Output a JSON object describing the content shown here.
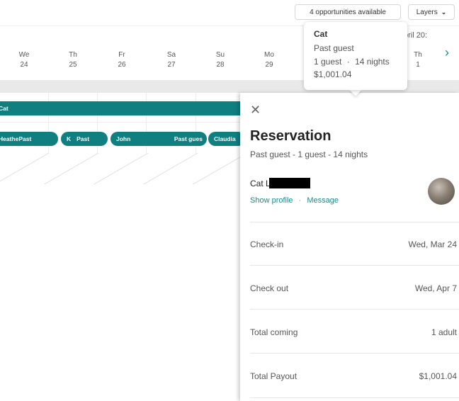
{
  "toolbar": {
    "opportunities_label": "4 opportunities available",
    "layers_label": "Layers"
  },
  "calendar": {
    "month_peek": "pril 20:",
    "days": [
      {
        "dow": "We",
        "num": "24"
      },
      {
        "dow": "Th",
        "num": "25"
      },
      {
        "dow": "Fr",
        "num": "26"
      },
      {
        "dow": "Sa",
        "num": "27"
      },
      {
        "dow": "Su",
        "num": "28"
      },
      {
        "dow": "Mo",
        "num": "29"
      },
      {
        "dow": "Th",
        "num": "1"
      }
    ],
    "bars": {
      "cat": "Cat",
      "b1": "HeathePast",
      "b2a": "K",
      "b2b": "Past",
      "b3a": "John",
      "b3b": "Past gues",
      "b4": "Claudia"
    }
  },
  "tooltip": {
    "name": "Cat",
    "status": "Past guest",
    "guests": "1 guest",
    "sep": "·",
    "nights": "14 nights",
    "price": "$1,001.04"
  },
  "reservation": {
    "title": "Reservation",
    "subtitle": "Past guest - 1 guest - 14 nights",
    "guest_name": "Cat L",
    "show_profile": "Show profile",
    "link_sep": "·",
    "message": "Message",
    "checkin_label": "Check-in",
    "checkin_value": "Wed, Mar 24",
    "checkout_label": "Check out",
    "checkout_value": "Wed, Apr 7",
    "coming_label": "Total coming",
    "coming_value": "1 adult",
    "payout_label": "Total Payout",
    "payout_value": "$1,001.04"
  },
  "colors": {
    "accent": "#0f7f80",
    "link": "#1a8a8a"
  },
  "icons": {
    "close": "close-icon",
    "chevron": "chevron-down-icon",
    "next": "chevron-right-icon"
  }
}
